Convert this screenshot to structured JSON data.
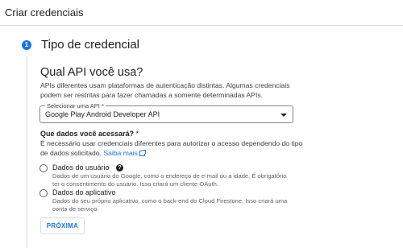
{
  "header": {
    "title": "Criar credenciais"
  },
  "step": {
    "number": "1",
    "title": "Tipo de credencial"
  },
  "api_section": {
    "heading": "Qual API você usa?",
    "description": "APIs diferentes usam plataformas de autenticação distintas. Algumas credenciais podem ser restritas para fazer chamadas a somente determinadas APIs.",
    "select_label": "Selecionar uma API *",
    "select_value": "Google Play Android Developer API"
  },
  "data_section": {
    "heading": "Que dados você acessará?",
    "required_mark": "*",
    "description": "É necessário usar credenciais diferentes para autorizar o acesso dependendo do tipo de dados solicitado.",
    "link_text": "Saiba mais",
    "options": [
      {
        "title": "Dados do usuário",
        "description": "Dados de um usuário do Google, como o endereço de e-mail ou a idade. É obrigatório ter o consentimento do usuário. Isso criará um cliente OAuth."
      },
      {
        "title": "Dados do aplicativo",
        "description": "Dados do seu próprio aplicativo, como o back-end do Cloud Firestone. Isso criará uma conta de serviço."
      }
    ]
  },
  "next_button": "PRÓXIMA",
  "icons": {
    "help": "help-circle-icon",
    "external_link": "open-in-new-icon",
    "dropdown": "caret-down-icon"
  },
  "colors": {
    "accent": "#1a73e8",
    "text": "#202124",
    "secondary_text": "#5f6368",
    "border": "#dadce0"
  }
}
